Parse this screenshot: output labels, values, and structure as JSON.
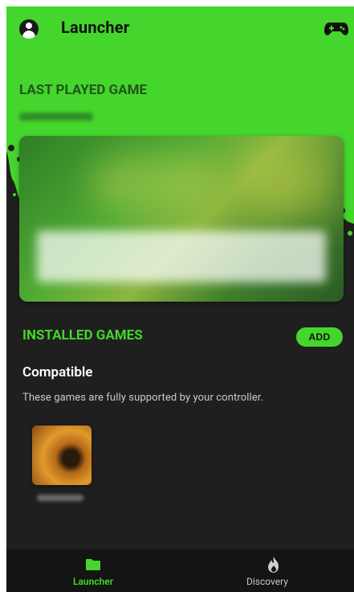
{
  "colors": {
    "accent": "#44d62c",
    "background": "#1f1f1f",
    "nav_background": "#141414"
  },
  "header": {
    "title": "Launcher",
    "left_icon": "account-circle-icon",
    "right_icon": "gamepad-icon"
  },
  "last_played": {
    "heading": "LAST PLAYED GAME"
  },
  "installed": {
    "heading": "INSTALLED GAMES",
    "add_label": "ADD",
    "compatible_title": "Compatible",
    "compatible_description": "These games are fully supported by your controller."
  },
  "bottom_nav": {
    "items": [
      {
        "label": "Launcher",
        "icon": "folder-icon",
        "active": true
      },
      {
        "label": "Discovery",
        "icon": "flame-icon",
        "active": false
      }
    ]
  }
}
